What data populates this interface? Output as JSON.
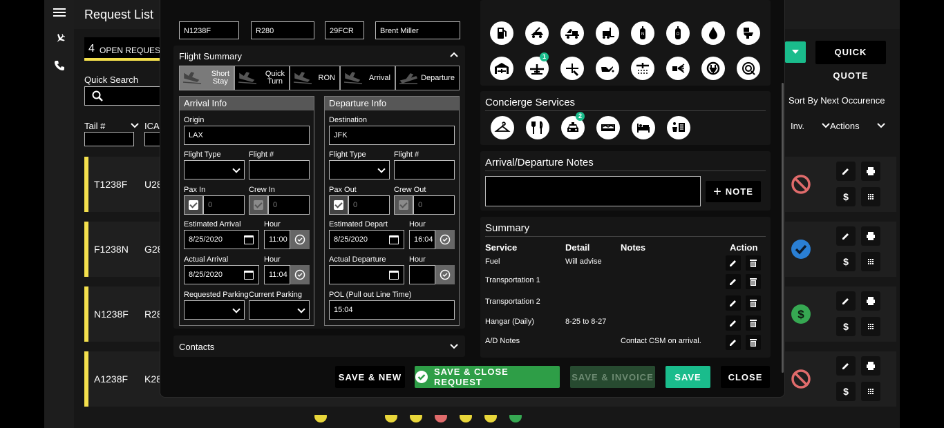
{
  "app": {
    "title": "Request List",
    "open_count": "4",
    "open_label": "OPEN REQUEST",
    "quick_search_label": "Quick Search",
    "quick_quote_label": "QUICK QUOTE",
    "sort_label": "Sort By Next Occurence",
    "columns": {
      "tail": "Tail #",
      "icao": "ICA",
      "inv": "Inv.",
      "actions": "Actions"
    }
  },
  "rows": [
    {
      "tail": "T1238F",
      "icao": "U28",
      "status": "denied"
    },
    {
      "tail": "F1238N",
      "icao": "G28",
      "status": "check"
    },
    {
      "tail": "N1238F",
      "icao": "R28",
      "status": "paid"
    },
    {
      "tail": "A1238F",
      "icao": "K28",
      "status": "denied"
    }
  ],
  "modal": {
    "top_fields": [
      "N1238F",
      "R280",
      "29FCR",
      "Brent Miller"
    ],
    "flight_summary": {
      "title": "Flight Summary",
      "types": [
        {
          "line1": "Short",
          "line2": "Stay",
          "active": true
        },
        {
          "line1": "Quick",
          "line2": "Turn",
          "active": false
        },
        {
          "line1": "RON",
          "line2": "",
          "active": false
        },
        {
          "line1": "Arrival",
          "line2": "",
          "active": false
        },
        {
          "line1": "Departure",
          "line2": "",
          "active": false
        }
      ]
    },
    "arrival": {
      "title": "Arrival Info",
      "origin_label": "Origin",
      "origin": "LAX",
      "flight_type_label": "Flight Type",
      "flight_type": "",
      "flight_no_label": "Flight #",
      "flight_no": "",
      "pax_label": "Pax In",
      "pax_value": "0",
      "crew_label": "Crew In",
      "crew_value": "0",
      "est_label": "Estimated Arrival",
      "est_date": "8/25/2020",
      "est_hour_label": "Hour",
      "est_hour": "11:00",
      "act_label": "Actual Arrival",
      "act_date": "8/25/2020",
      "act_hour_label": "Hour",
      "act_hour": "11:04",
      "req_parking_label": "Requested Parking",
      "req_parking": "",
      "cur_parking_label": "Current Parking",
      "cur_parking": ""
    },
    "departure": {
      "title": "Departure Info",
      "dest_label": "Destination",
      "dest": "JFK",
      "flight_type_label": "Flight Type",
      "flight_type": "",
      "flight_no_label": "Flight #",
      "flight_no": "",
      "pax_label": "Pax Out",
      "pax_value": "0",
      "crew_label": "Crew Out",
      "crew_value": "0",
      "est_label": "Estimated Depart",
      "est_date": "8/25/2020",
      "est_hour_label": "Hour",
      "est_hour": "16:04",
      "act_label": "Actual Departure",
      "act_date": "",
      "act_hour_label": "Hour",
      "act_hour": "",
      "pol_label": "POL (Pull out Line Time)",
      "pol": "15:04"
    },
    "contacts_label": "Contacts",
    "services_row1": [
      {
        "icon": "fuel-pump-icon",
        "badge": ""
      },
      {
        "icon": "tow-tug-icon",
        "badge": ""
      },
      {
        "icon": "baggage-cart-icon",
        "badge": ""
      },
      {
        "icon": "forklift-icon",
        "badge": ""
      },
      {
        "icon": "nitrogen-tank-icon",
        "badge": ""
      },
      {
        "icon": "oxygen-tank-icon",
        "badge": ""
      },
      {
        "icon": "water-drop-icon",
        "badge": ""
      },
      {
        "icon": "lavatory-icon",
        "badge": ""
      }
    ],
    "services_row2": [
      {
        "icon": "hangar-icon",
        "badge": ""
      },
      {
        "icon": "aircraft-service-icon",
        "badge": "1"
      },
      {
        "icon": "maintenance-icon",
        "badge": ""
      },
      {
        "icon": "oil-can-icon",
        "badge": ""
      },
      {
        "icon": "deice-icon",
        "badge": ""
      },
      {
        "icon": "spray-wash-icon",
        "badge": ""
      },
      {
        "icon": "ground-power-icon",
        "badge": ""
      },
      {
        "icon": "gpu-cart-icon",
        "badge": ""
      }
    ],
    "concierge": {
      "title": "Concierge Services",
      "items": [
        {
          "icon": "hanger-laundry-icon",
          "badge": ""
        },
        {
          "icon": "catering-icon",
          "badge": ""
        },
        {
          "icon": "taxi-icon",
          "badge": "2"
        },
        {
          "icon": "rental-car-icon",
          "badge": ""
        },
        {
          "icon": "hotel-bed-icon",
          "badge": ""
        },
        {
          "icon": "coffee-news-icon",
          "badge": ""
        }
      ]
    },
    "notes": {
      "title": "Arrival/Departure Notes",
      "value": "",
      "add_label": "NOTE"
    },
    "summary": {
      "title": "Summary",
      "headers": {
        "service": "Service",
        "detail": "Detail",
        "notes": "Notes",
        "action": "Action"
      },
      "rows": [
        {
          "service": "Fuel",
          "detail": "Will advise",
          "notes": ""
        },
        {
          "service": "Transportation 1",
          "detail": "",
          "notes": ""
        },
        {
          "service": "Transportation 2",
          "detail": "",
          "notes": ""
        },
        {
          "service": "Hangar (Daily)",
          "detail": "8-25 to 8-27",
          "notes": ""
        },
        {
          "service": "A/D Notes",
          "detail": "",
          "notes": "Contact CSM on arrival."
        }
      ]
    },
    "footer": {
      "save_new": "SAVE & NEW",
      "save_close": "SAVE & CLOSE REQUEST",
      "save_invoice": "SAVE & INVOICE",
      "save": "SAVE",
      "close": "CLOSE"
    }
  },
  "colors": {
    "accent": "#1abc8c",
    "green_btn": "#2e9e47",
    "stripe": "#f4e04d",
    "danger": "#e06b6b",
    "blue_check": "#2a7fd4",
    "paid_green": "#36a852"
  }
}
